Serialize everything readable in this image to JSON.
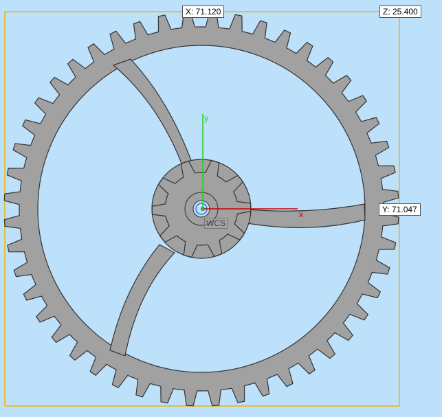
{
  "dimensions": {
    "x": "X: 71.120",
    "y": "Y: 71.047",
    "z": "Z: 25.400"
  },
  "triad": {
    "x_label": "x",
    "y_label": "y",
    "wcs_label": "WCS"
  },
  "colors": {
    "background": "#bde0fb",
    "bounding_box": "#f0b400",
    "gear_fill": "#a1a1a1",
    "gear_edge": "#333333",
    "x_axis": "#cc0000",
    "y_axis": "#22cc22"
  },
  "model": {
    "large_gear_teeth": 48,
    "small_gear_teeth": 10,
    "spokes": 3
  }
}
